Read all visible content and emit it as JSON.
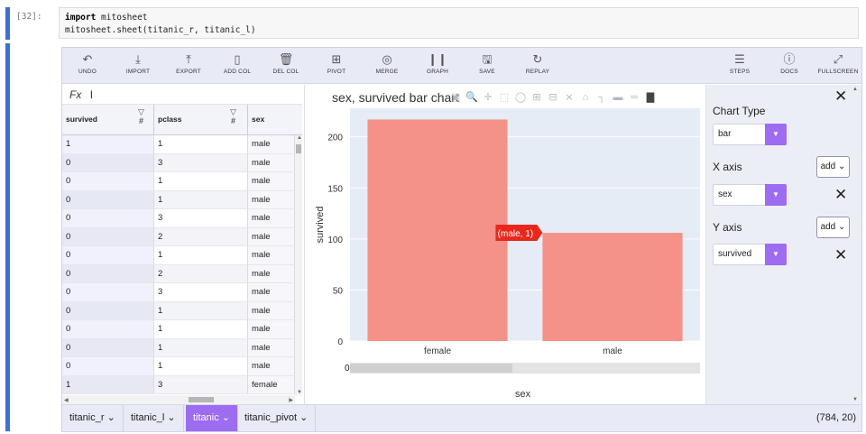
{
  "cell": {
    "prompt": "[32]:",
    "code_line1_kw": "import",
    "code_line1_rest": " mitosheet",
    "code_line2": "mitosheet.sheet(titanic_r, titanic_l)"
  },
  "toolbar": {
    "undo": "UNDO",
    "import": "IMPORT",
    "export": "EXPORT",
    "add_col": "ADD COL",
    "del_col": "DEL COL",
    "pivot": "PIVOT",
    "merge": "MERGE",
    "graph": "GRAPH",
    "save": "SAVE",
    "replay": "REPLAY",
    "steps": "STEPS",
    "docs": "DOCS",
    "fullscreen": "FULLSCREEN"
  },
  "grid": {
    "formula_label": "Fx",
    "formula_value": "I",
    "columns": [
      "survived",
      "pclass",
      "sex"
    ],
    "rows": [
      [
        "1",
        "1",
        "male"
      ],
      [
        "0",
        "3",
        "male"
      ],
      [
        "0",
        "1",
        "male"
      ],
      [
        "0",
        "1",
        "male"
      ],
      [
        "0",
        "3",
        "male"
      ],
      [
        "0",
        "2",
        "male"
      ],
      [
        "0",
        "1",
        "male"
      ],
      [
        "0",
        "2",
        "male"
      ],
      [
        "0",
        "3",
        "male"
      ],
      [
        "0",
        "1",
        "male"
      ],
      [
        "0",
        "1",
        "male"
      ],
      [
        "0",
        "1",
        "male"
      ],
      [
        "0",
        "1",
        "male"
      ],
      [
        "1",
        "3",
        "female"
      ]
    ]
  },
  "chart": {
    "title": "sex, survived bar chart",
    "tooltip": "(male, 1)",
    "range_zero": "0"
  },
  "chart_data": {
    "type": "bar",
    "title": "sex, survived bar chart",
    "categories": [
      "female",
      "male"
    ],
    "values": [
      217,
      106
    ],
    "xlabel": "sex",
    "ylabel": "survived",
    "ylim": [
      0,
      228
    ],
    "yticks": [
      0,
      50,
      100,
      150,
      200
    ],
    "bar_color": "#f4928a",
    "grid": true
  },
  "config": {
    "chart_type_label": "Chart Type",
    "chart_type_value": "bar",
    "x_axis_label": "X axis",
    "x_axis_value": "sex",
    "y_axis_label": "Y axis",
    "y_axis_value": "survived",
    "add_label": "add"
  },
  "footer": {
    "tabs": [
      "titanic_r",
      "titanic_l",
      "titanic",
      "titanic_pivot"
    ],
    "active_tab": "titanic",
    "coords": "(784, 20)"
  },
  "colors": {
    "accent": "#9d6cf0",
    "toolbar_bg": "#e8eaf6",
    "cell_bar": "#3d6fd6"
  }
}
